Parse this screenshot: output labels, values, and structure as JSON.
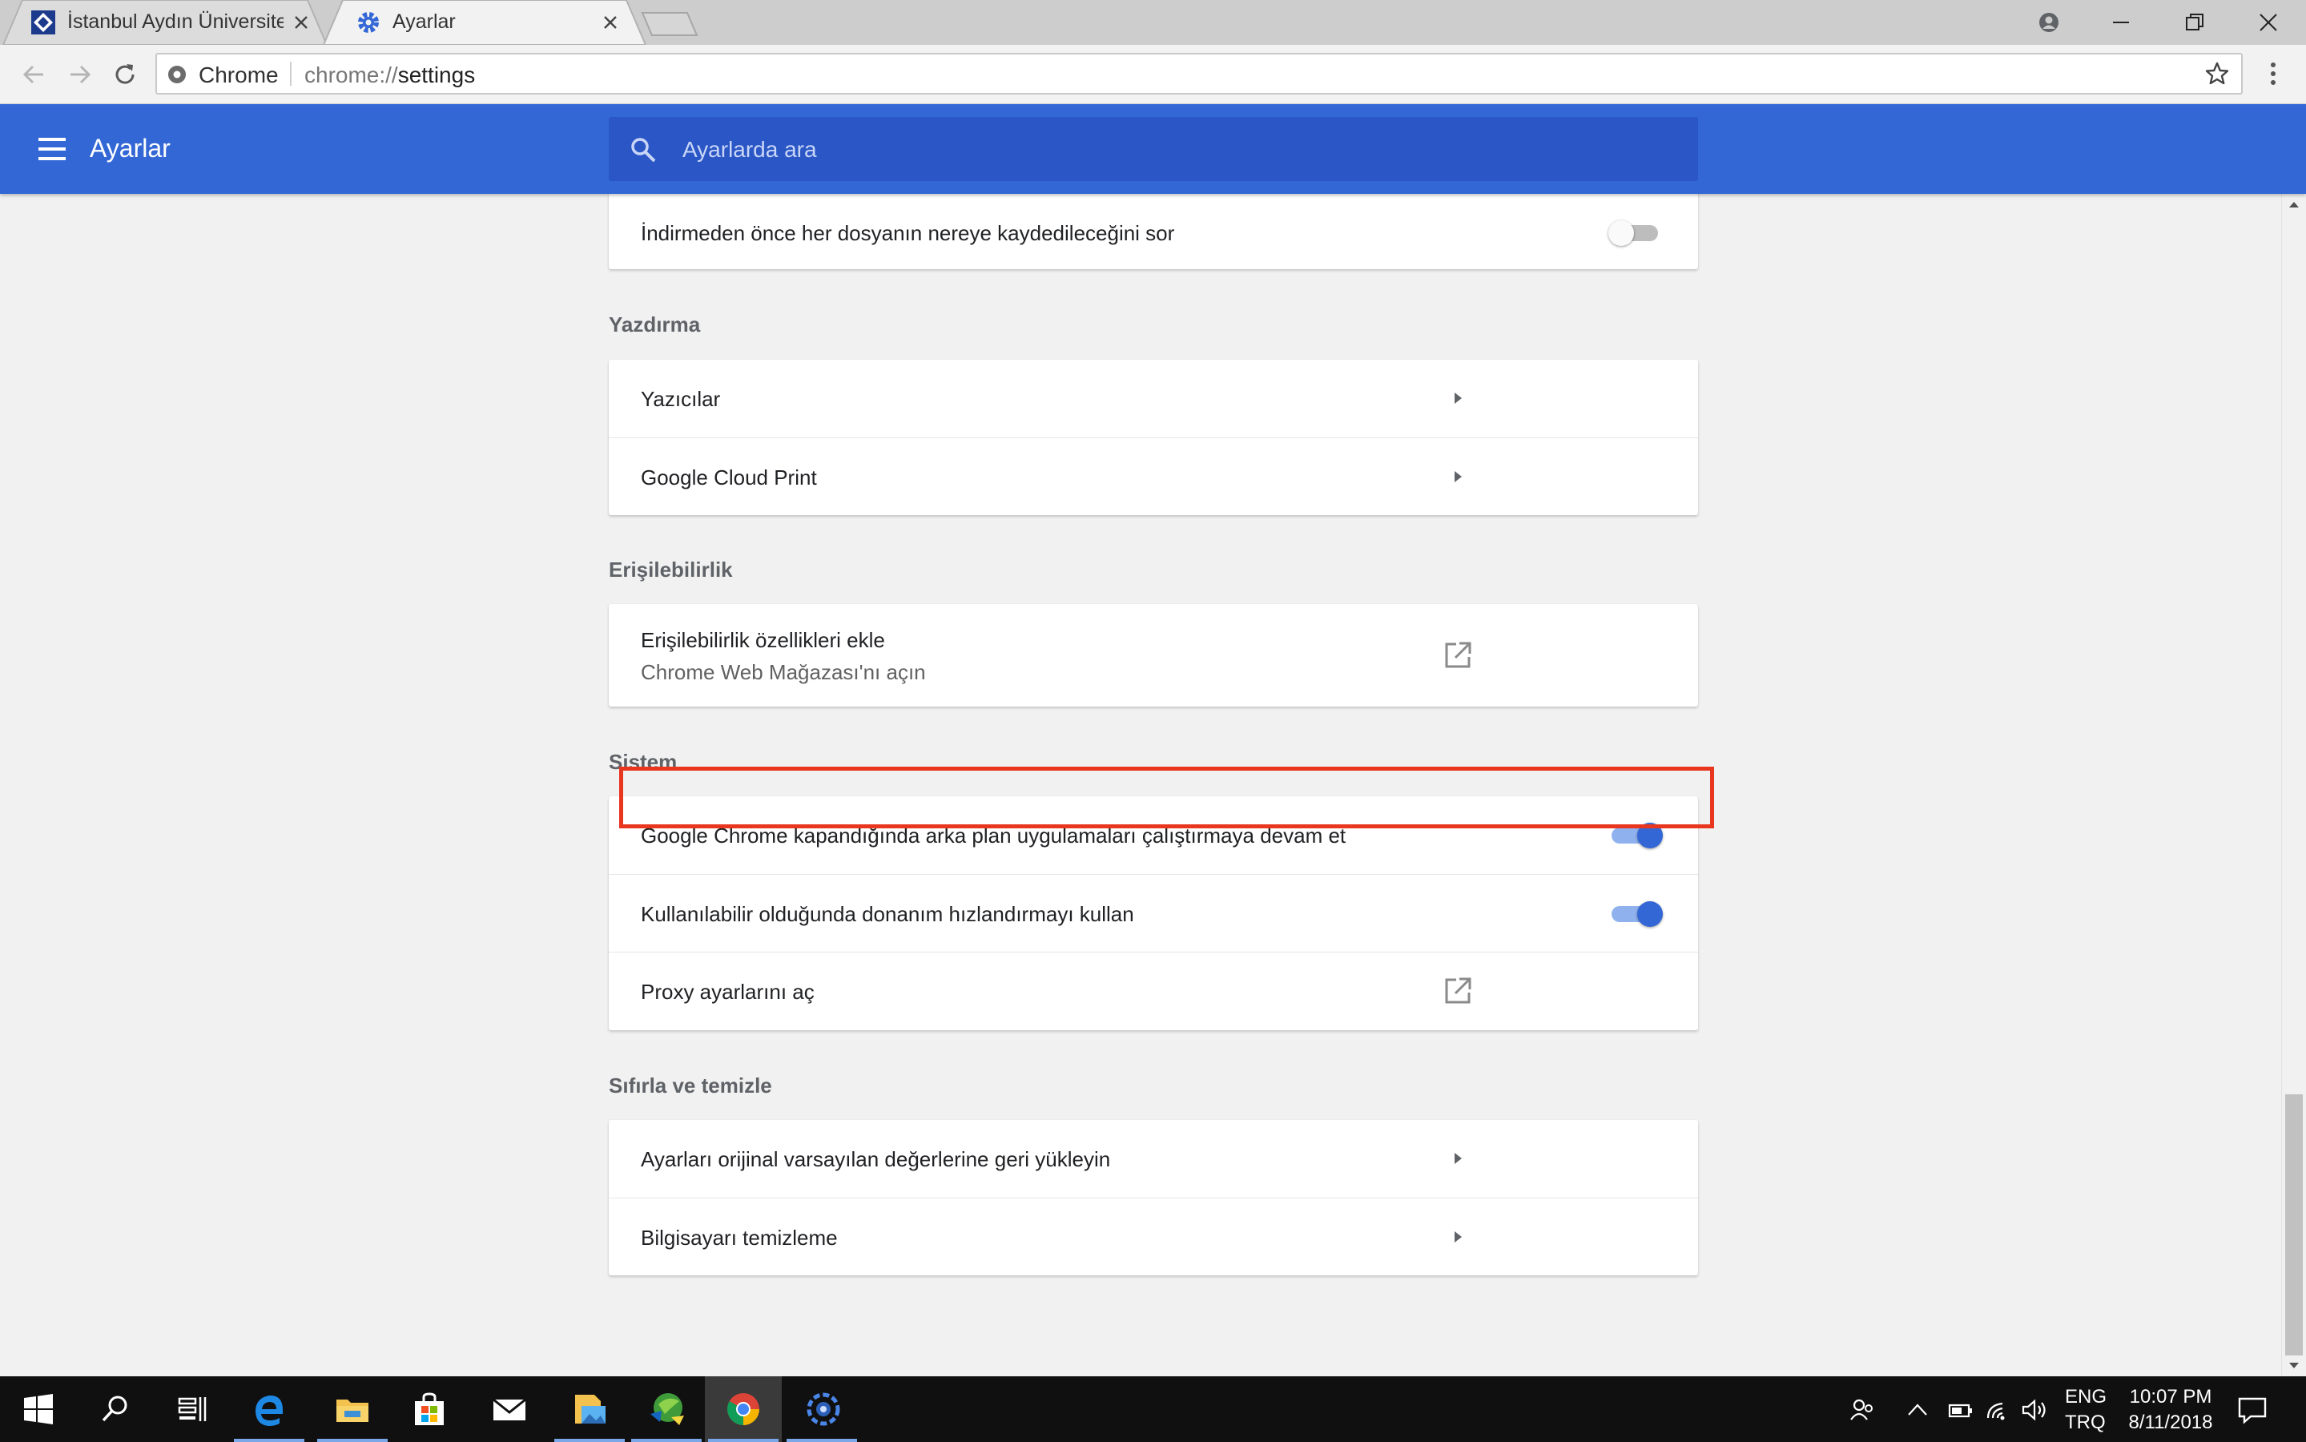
{
  "browser": {
    "tabs": [
      {
        "title": "İstanbul Aydın Üniversitesi",
        "active": false
      },
      {
        "title": "Ayarlar",
        "active": true
      }
    ],
    "omnibox": {
      "chip": "Chrome",
      "scheme": "chrome://",
      "host": "settings"
    }
  },
  "header": {
    "title": "Ayarlar",
    "search_placeholder": "Ayarlarda ara"
  },
  "downloads": {
    "ask_location_label": "İndirmeden önce her dosyanın nereye kaydedileceğini sor",
    "ask_location_enabled": false
  },
  "printing": {
    "title": "Yazdırma",
    "items": [
      {
        "label": "Yazıcılar"
      },
      {
        "label": "Google Cloud Print"
      }
    ]
  },
  "accessibility": {
    "title": "Erişilebilirlik",
    "item": {
      "label": "Erişilebilirlik özellikleri ekle",
      "sublabel": "Chrome Web Mağazası'nı açın"
    }
  },
  "system": {
    "title": "Sistem",
    "background_apps": {
      "label": "Google Chrome kapandığında arka plan uygulamaları çalıştırmaya devam et",
      "enabled": true
    },
    "hardware_accel": {
      "label": "Kullanılabilir olduğunda donanım hızlandırmayı kullan",
      "enabled": true
    },
    "proxy": {
      "label": "Proxy ayarlarını aç",
      "highlight_color": "#e8361f"
    }
  },
  "reset": {
    "title": "Sıfırla ve temizle",
    "items": [
      {
        "label": "Ayarları orijinal varsayılan değerlerine geri yükleyin"
      },
      {
        "label": "Bilgisayarı temizleme"
      }
    ]
  },
  "taskbar": {
    "apps": [
      "start-icon",
      "search-icon",
      "task-view-icon",
      "edge-icon",
      "file-explorer-icon",
      "store-icon",
      "mail-icon",
      "photos-icon",
      "download-manager-icon",
      "chrome-icon",
      "settings-app-icon"
    ],
    "language": {
      "line1": "ENG",
      "line2": "TRQ"
    },
    "clock": {
      "time": "10:07 PM",
      "date": "8/11/2018"
    }
  },
  "colors": {
    "accent": "#3367d6",
    "header_search": "#2a56c6",
    "highlight": "#e8361f"
  }
}
